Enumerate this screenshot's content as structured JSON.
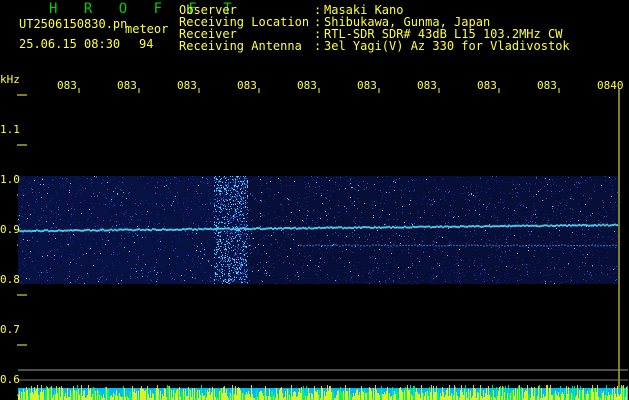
{
  "app": {
    "brand": "H R O F F T",
    "file_name": "UT2506150830.pn",
    "meteor_label": "meteor",
    "date_time": "25.06.15 08:30",
    "count": "94",
    "frequency_unit": "kHz"
  },
  "station_info": [
    {
      "label": "Observer",
      "separator": ":",
      "value": "Masaki Kano"
    },
    {
      "label": "Receiving Location",
      "separator": ":",
      "value": "Shibukawa, Gunma, Japan"
    },
    {
      "label": "Receiver",
      "separator": ":",
      "value": "RTL-SDR SDR# 43dB L15 103.2MHz CW"
    },
    {
      "label": "Receiving Antenna",
      "separator": ":",
      "value": "3el Yagi(V) Az 330 for Vladivostok"
    }
  ],
  "frequency_axis": [
    "1.1",
    "1.0",
    "0.9",
    "0.8",
    "0.7",
    "0.6"
  ],
  "time_axis": [
    "083",
    "083",
    "083",
    "083",
    "083",
    "083",
    "083",
    "083",
    "083",
    "0840"
  ],
  "colors": {
    "background": "#000000",
    "text": "#ffff40",
    "brand": "#00d000",
    "signal_low": "#0d1a63",
    "signal_high": "#36d8ff",
    "baseline": "#20d0ff"
  }
}
